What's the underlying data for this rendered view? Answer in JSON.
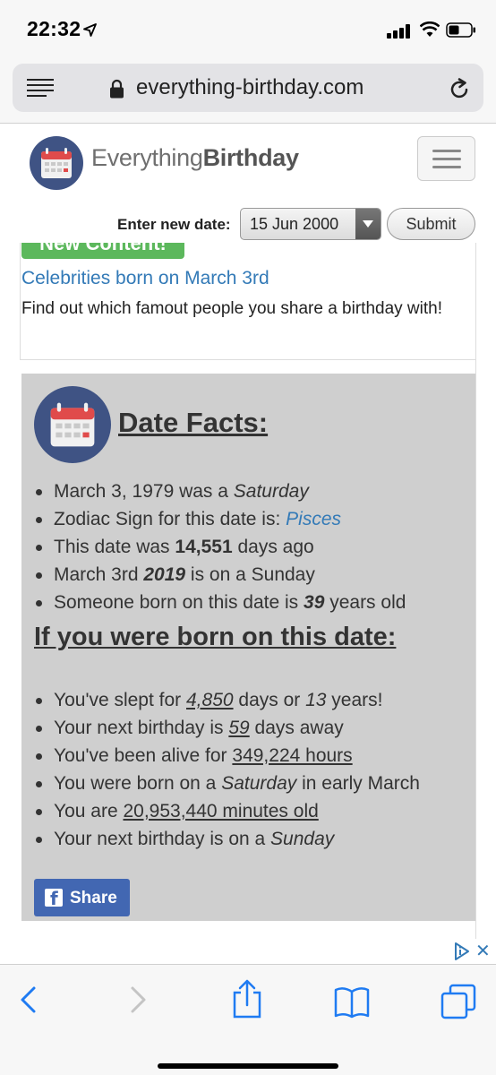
{
  "status_bar": {
    "time": "22:32"
  },
  "browser": {
    "url": "everything-birthday.com"
  },
  "header": {
    "brand_light": "Everything",
    "brand_bold": "Birthday",
    "date_label": "Enter new date:",
    "date_value": "15 Jun 2000",
    "submit_label": "Submit"
  },
  "promo": {
    "badge": "New Content!",
    "link": "Celebrities born on March 3rd",
    "description": "Find out which famout people you share a birthday with!"
  },
  "facts": {
    "title": "Date Facts:",
    "item1": {
      "text": "March 3, 1979 was a ",
      "em": "Saturday"
    },
    "item2": {
      "text": "Zodiac Sign for this date is: ",
      "link": "Pisces"
    },
    "item3": {
      "pre": "This date was ",
      "bold": "14,551",
      "post": " days ago"
    },
    "item4": {
      "pre": "March 3rd ",
      "bold": "2019",
      "post": " is on a Sunday"
    },
    "item5": {
      "pre": "Someone born on this date is ",
      "bold": "39",
      "post": " years old"
    }
  },
  "born": {
    "title": "If you were born on this date:",
    "item1": {
      "pre": "You've slept for ",
      "u": "4,850",
      "mid": " days or ",
      "em": "13",
      "post": " years!"
    },
    "item2": {
      "pre": "Your next birthday is ",
      "u": "59",
      "post": " days away"
    },
    "item3": {
      "pre": "You've been alive for ",
      "u": "349,224 hours"
    },
    "item4": {
      "pre": "You were born on a ",
      "em": "Saturday",
      "post": " in early March"
    },
    "item5": {
      "pre": "You are ",
      "u": "20,953,440 minutes old"
    },
    "item6": {
      "pre": "Your next birthday is on a ",
      "em": "Sunday"
    }
  },
  "share": {
    "label": "Share"
  },
  "ad": {
    "close": "✕"
  },
  "icons": [
    "location-arrow-icon",
    "signal-icon",
    "wifi-icon",
    "battery-icon",
    "reader-icon",
    "lock-icon",
    "reload-icon",
    "calendar-icon",
    "menu-icon",
    "facebook-icon",
    "ad-choices-icon",
    "back-icon",
    "forward-icon",
    "share-icon",
    "bookmarks-icon",
    "tabs-icon"
  ],
  "colors": {
    "accent": "#337ab7",
    "badge": "#5cb85c",
    "facebook": "#4267b2",
    "calendar_red": "#e04b4b",
    "calendar_navy": "#3f5384"
  }
}
